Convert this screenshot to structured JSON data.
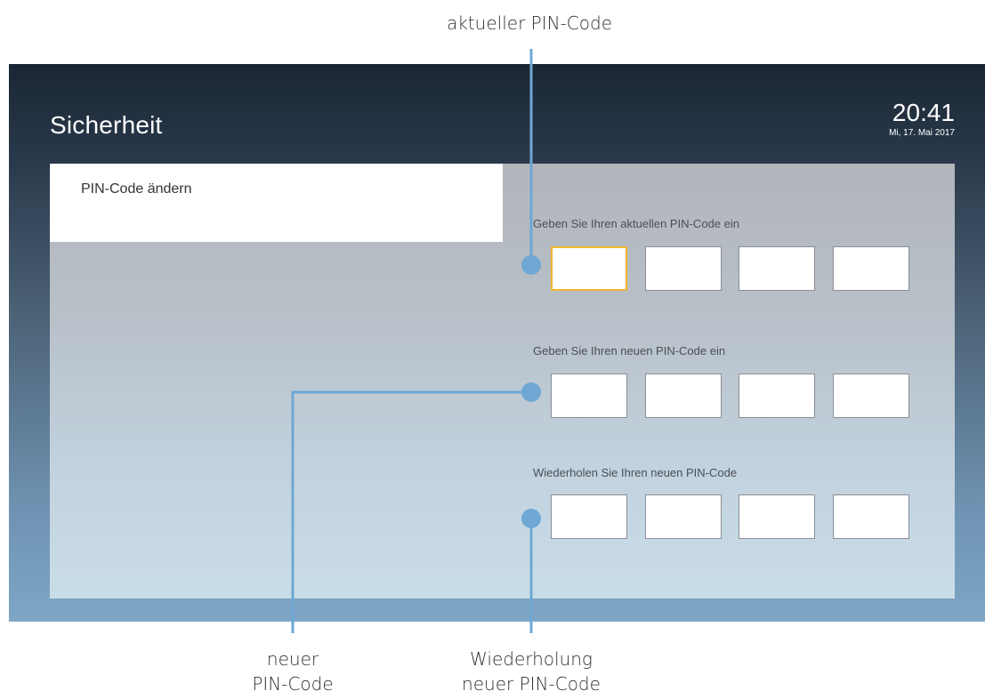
{
  "screen": {
    "title": "Sicherheit",
    "clock": {
      "time": "20:41",
      "date": "Mi, 17. Mai 2017"
    }
  },
  "menu": {
    "items": [
      {
        "label": "PIN-Code ändern",
        "selected": true
      }
    ]
  },
  "pin_form": {
    "current": {
      "label": "Geben Sie Ihren aktuellen PIN-Code ein",
      "focused_digit": 1
    },
    "new": {
      "label": "Geben Sie Ihren neuen PIN-Code ein"
    },
    "repeat": {
      "label": "Wiederholen Sie Ihren neuen PIN-Code"
    }
  },
  "callouts": {
    "top": "aktueller PIN-Code",
    "bottom_left_line1": "neuer",
    "bottom_left_line2": "PIN-Code",
    "bottom_right_line1": "Wiederholung",
    "bottom_right_line2": "neuer PIN-Code"
  },
  "colors": {
    "focus": "#f0b62f",
    "callout_line": "#6fa8d4"
  }
}
